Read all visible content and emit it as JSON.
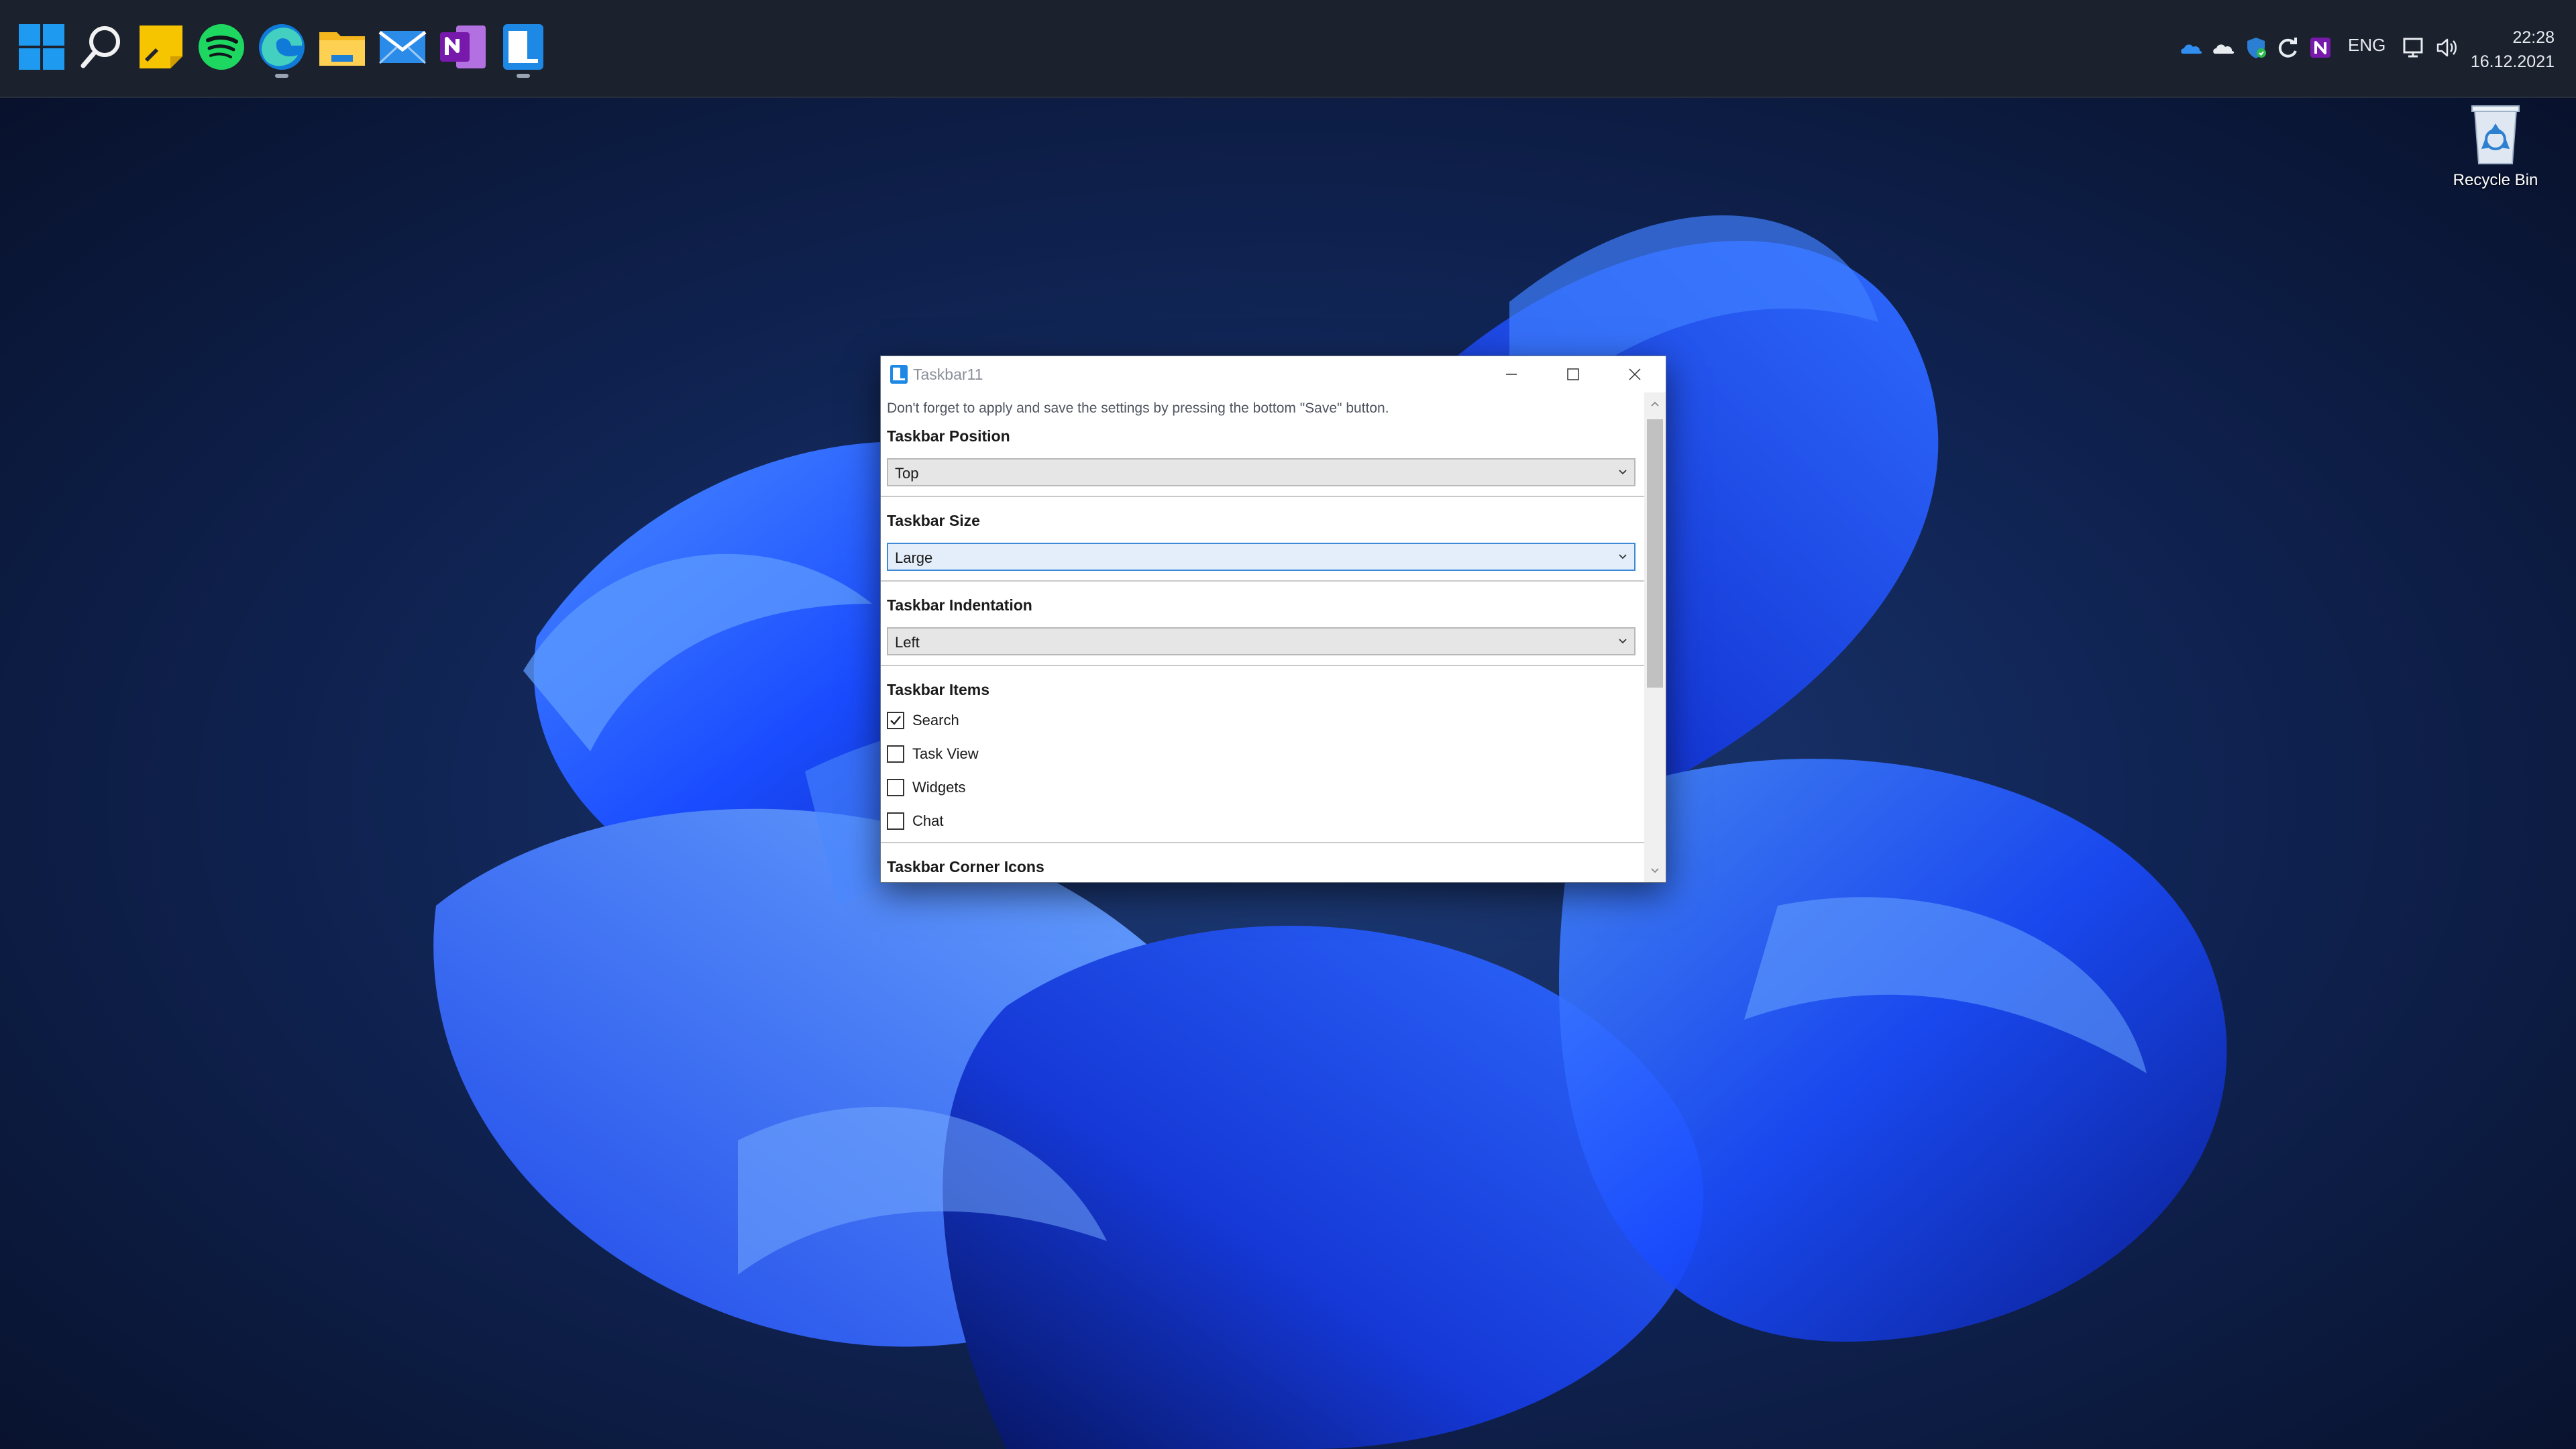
{
  "taskbar": {
    "apps": [
      {
        "name": "start-icon",
        "running": false
      },
      {
        "name": "search-icon",
        "running": false
      },
      {
        "name": "sticky-notes-icon",
        "running": false
      },
      {
        "name": "spotify-icon",
        "running": false
      },
      {
        "name": "edge-icon",
        "running": true
      },
      {
        "name": "file-explorer-icon",
        "running": false
      },
      {
        "name": "mail-icon",
        "running": false
      },
      {
        "name": "onenote-icon",
        "running": false
      },
      {
        "name": "taskbar11-icon",
        "running": true
      }
    ],
    "tray_icons": [
      "onedrive-icon",
      "cloud-icon",
      "security-icon",
      "sync-icon",
      "onenote-tray-icon"
    ],
    "language": "ENG",
    "time": "22:28",
    "date": "16.12.2021"
  },
  "desktop": {
    "recycle_bin_label": "Recycle Bin"
  },
  "window": {
    "title": "Taskbar11",
    "notice": "Don't forget to apply and save the settings by pressing the bottom \"Save\" button.",
    "sections": {
      "position": {
        "title": "Taskbar Position",
        "value": "Top"
      },
      "size": {
        "title": "Taskbar Size",
        "value": "Large"
      },
      "indentation": {
        "title": "Taskbar Indentation",
        "value": "Left"
      },
      "items": {
        "title": "Taskbar Items",
        "checkboxes": [
          {
            "label": "Search",
            "checked": true
          },
          {
            "label": "Task View",
            "checked": false
          },
          {
            "label": "Widgets",
            "checked": false
          },
          {
            "label": "Chat",
            "checked": false
          }
        ]
      },
      "corner_icons": {
        "title": "Taskbar Corner Icons"
      }
    }
  },
  "colors": {
    "accent": "#0078d4",
    "taskbar_bg": "#1b212d",
    "wallpaper_dark": "#0a1530",
    "bloom_blue": "#1a4cff"
  }
}
